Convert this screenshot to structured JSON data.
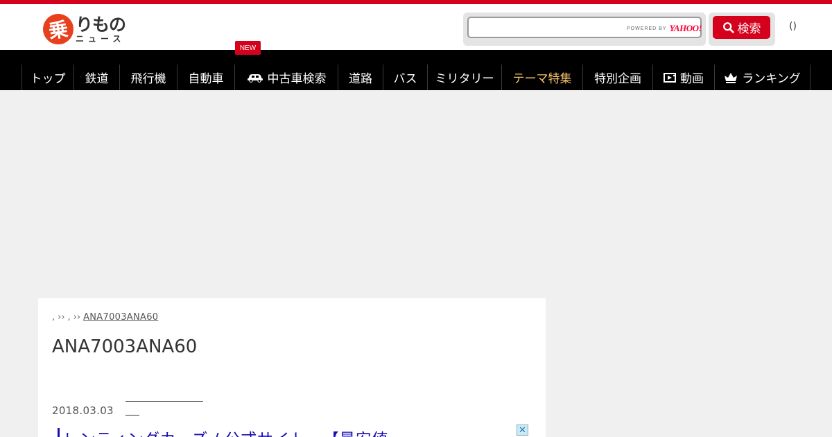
{
  "header": {
    "logo_mark": "乗",
    "logo_main": "りもの",
    "logo_sub": "ニュース",
    "extra_text": "()",
    "accent_color": "#d5001c"
  },
  "search": {
    "value": "",
    "powered_by": "POWERED BY",
    "provider": "YAHOO!",
    "button_label": "検索",
    "button_icon": "search-icon"
  },
  "nav": {
    "new_badge": "NEW",
    "items": [
      {
        "label": "トップ",
        "icon": ""
      },
      {
        "label": "鉄道",
        "icon": ""
      },
      {
        "label": "飛行機",
        "icon": ""
      },
      {
        "label": "自動車",
        "icon": ""
      },
      {
        "label": "中古車検索",
        "icon": "car-icon"
      },
      {
        "label": "道路",
        "icon": ""
      },
      {
        "label": "バス",
        "icon": ""
      },
      {
        "label": "ミリタリー",
        "icon": ""
      },
      {
        "label": "テーマ特集",
        "icon": "",
        "highlight": true,
        "highlight_color": "#f7c56b"
      },
      {
        "label": "特別企画",
        "icon": ""
      },
      {
        "label": "動画",
        "icon": "video-icon"
      },
      {
        "label": "ランキング",
        "icon": "crown-icon"
      }
    ]
  },
  "article": {
    "breadcrumb": {
      "sep1": ",",
      "sep2": "››",
      "sep3": ",",
      "sep4": "››",
      "current": "ANA7003ANA60"
    },
    "title": "ANA7003ANA60",
    "date": "2018.03.03",
    "sponsored_text": "レンティングカーズ / 公式サイト - 【最安値"
  }
}
